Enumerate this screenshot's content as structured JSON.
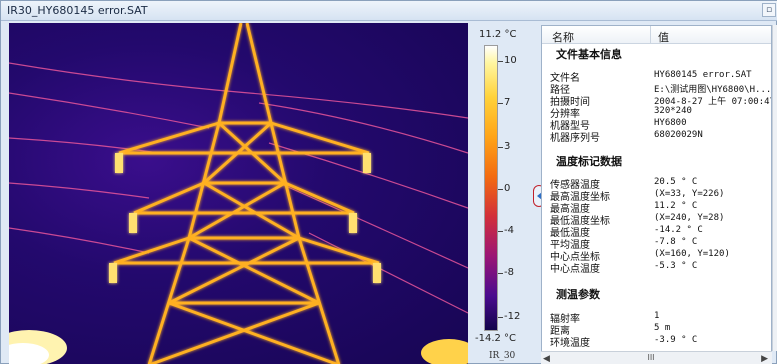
{
  "window": {
    "title": "IR30_HY680145 error.SAT"
  },
  "scale": {
    "max_label": "11.2 °C",
    "min_label": "-14.2 °C",
    "ticks": [
      "10",
      "7",
      "3",
      "0",
      "-4",
      "-8",
      "-12"
    ],
    "source": "IR_30"
  },
  "panel": {
    "header": {
      "name": "名称",
      "value": "值"
    },
    "groups": [
      {
        "title": "文件基本信息",
        "rows": [
          {
            "name": "文件名",
            "value": "HY680145 error.SAT"
          },
          {
            "name": "路径",
            "value": "E:\\测试用图\\HY6800\\H..."
          },
          {
            "name": "拍摄时间",
            "value": "2004-8-27 上午 07:00:47"
          },
          {
            "name": "分辨率",
            "value": "320*240"
          },
          {
            "name": "机器型号",
            "value": "HY6800"
          },
          {
            "name": "机器序列号",
            "value": "68020029N"
          }
        ]
      },
      {
        "title": "温度标记数据",
        "rows": [
          {
            "name": "传感器温度",
            "value": "20.5 ° C"
          },
          {
            "name": "最高温度坐标",
            "value": "(X=33, Y=226)"
          },
          {
            "name": "最高温度",
            "value": "11.2 ° C"
          },
          {
            "name": "最低温度坐标",
            "value": "(X=240, Y=28)"
          },
          {
            "name": "最低温度",
            "value": "-14.2 ° C"
          },
          {
            "name": "平均温度",
            "value": "-7.8 ° C"
          },
          {
            "name": "中心点坐标",
            "value": "(X=160, Y=120)"
          },
          {
            "name": "中心点温度",
            "value": "-5.3 ° C"
          }
        ]
      },
      {
        "title": "测温参数",
        "rows": [
          {
            "name": "辐射率",
            "value": "1"
          },
          {
            "name": "距离",
            "value": "5 m"
          },
          {
            "name": "环境温度",
            "value": "-3.9 ° C"
          }
        ]
      }
    ],
    "hscroll_thumb": "III"
  },
  "colors": {
    "hot": "#ffd23a",
    "cold": "#170553",
    "accent": "#c0202a"
  },
  "icons": {
    "scroll_left": "chevron-left-icon",
    "scroll_right": "chevron-right-icon",
    "splitter": "chevron-left-icon"
  }
}
